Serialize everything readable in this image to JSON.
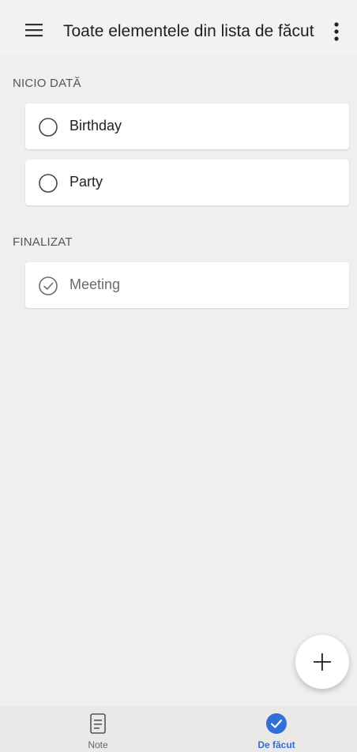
{
  "header": {
    "title": "Toate elementele din lista de făcut",
    "menu_icon": "hamburger-menu-icon",
    "more_icon": "more-vertical-icon"
  },
  "sections": [
    {
      "title": "NICIO DATĂ",
      "items": [
        {
          "label": "Birthday",
          "completed": false
        },
        {
          "label": "Party",
          "completed": false
        }
      ]
    },
    {
      "title": "FINALIZAT",
      "items": [
        {
          "label": "Meeting",
          "completed": true
        }
      ]
    }
  ],
  "fab": {
    "icon": "plus-icon"
  },
  "bottom_nav": {
    "items": [
      {
        "label": "Note",
        "icon": "note-document-icon",
        "active": false
      },
      {
        "label": "De făcut",
        "icon": "checkmark-circle-icon",
        "active": true
      }
    ]
  },
  "colors": {
    "accent": "#2f6fd6",
    "background": "#f1efee",
    "card": "#ffffff"
  }
}
